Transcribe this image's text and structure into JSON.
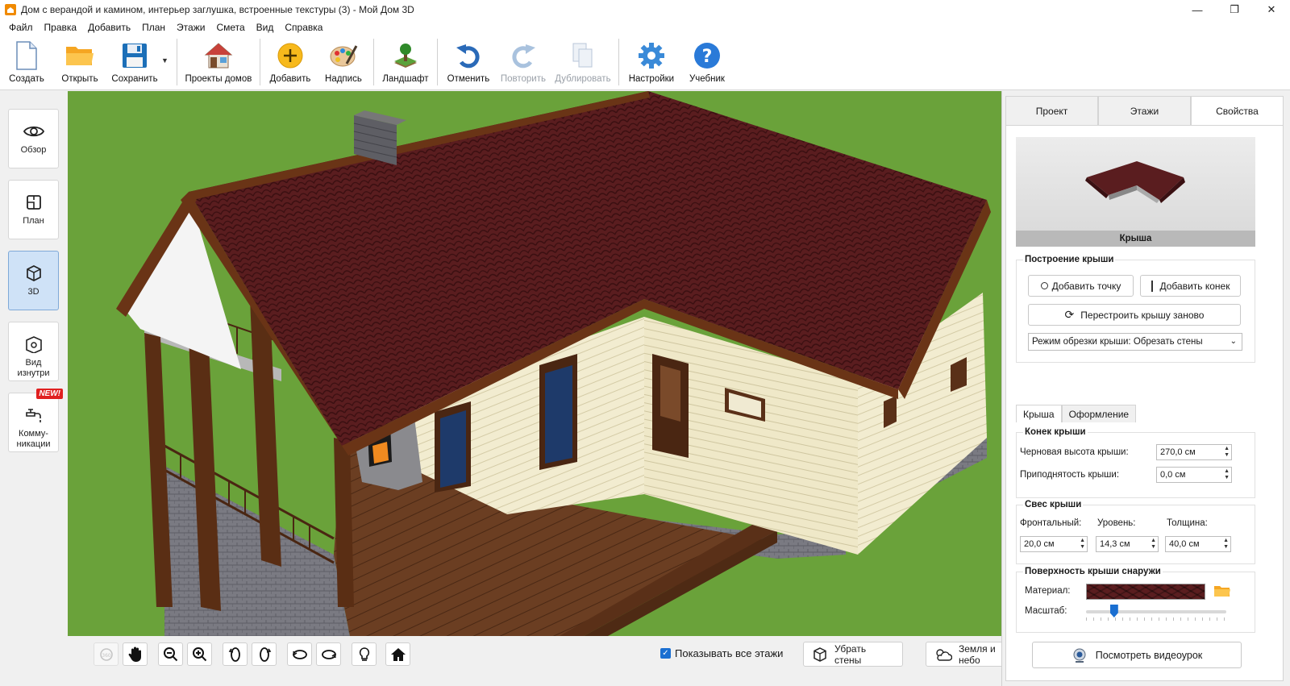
{
  "window": {
    "title": "Дом с верандой и камином, интерьер заглушка, встроенные текстуры (3) - Мой Дом 3D",
    "minimize_glyph": "—",
    "maximize_glyph": "❐",
    "close_glyph": "✕"
  },
  "menu": [
    "Файл",
    "Правка",
    "Добавить",
    "План",
    "Этажи",
    "Смета",
    "Вид",
    "Справка"
  ],
  "toolbar": {
    "create": "Создать",
    "open": "Открыть",
    "save": "Сохранить",
    "house_projects": "Проекты домов",
    "add": "Добавить",
    "label": "Надпись",
    "landscape": "Ландшафт",
    "undo": "Отменить",
    "redo": "Повторить",
    "duplicate": "Дублировать",
    "settings": "Настройки",
    "tutorial": "Учебник"
  },
  "left_panel": {
    "overview": "Обзор",
    "plan": "План",
    "view3d": "3D",
    "inside_view_1": "Вид",
    "inside_view_2": "изнутри",
    "comms_1": "Комму-",
    "comms_2": "никации",
    "new_badge": "NEW!"
  },
  "bottom_bar": {
    "show_all_floors": "Показывать все этажи",
    "remove_walls": "Убрать стены",
    "ground_sky": "Земля и небо"
  },
  "right_panel": {
    "tabs": [
      "Проект",
      "Этажи",
      "Свойства"
    ],
    "preview_caption": "Крыша",
    "roof_construction": {
      "title": "Построение крыши",
      "add_point": "Добавить точку",
      "add_ridge": "Добавить конек",
      "rebuild": "Перестроить крышу заново",
      "trim_mode": "Режим обрезки крыши: Обрезать стены"
    },
    "subtabs": [
      "Крыша",
      "Оформление"
    ],
    "ridge": {
      "title": "Конек крыши",
      "rough_height_label": "Черновая высота крыши:",
      "rough_height_value": "270,0 см",
      "raise_label": "Приподнятость крыши:",
      "raise_value": "0,0 см"
    },
    "overhang": {
      "title": "Свес крыши",
      "frontal_label": "Фронтальный:",
      "frontal_value": "20,0 см",
      "level_label": "Уровень:",
      "level_value": "14,3 см",
      "thickness_label": "Толщина:",
      "thickness_value": "40,0 см"
    },
    "surface": {
      "title": "Поверхность крыши снаружи",
      "material_label": "Материал:",
      "scale_label": "Масштаб:",
      "scale_position": 0.2
    },
    "video_lesson": "Посмотреть видеоурок"
  },
  "colors": {
    "accent": "#1a6fd1",
    "grass": "#6aa23a",
    "roof": "#5a1d1f",
    "walls": "#efe8c8",
    "deck": "#6b3e22"
  }
}
